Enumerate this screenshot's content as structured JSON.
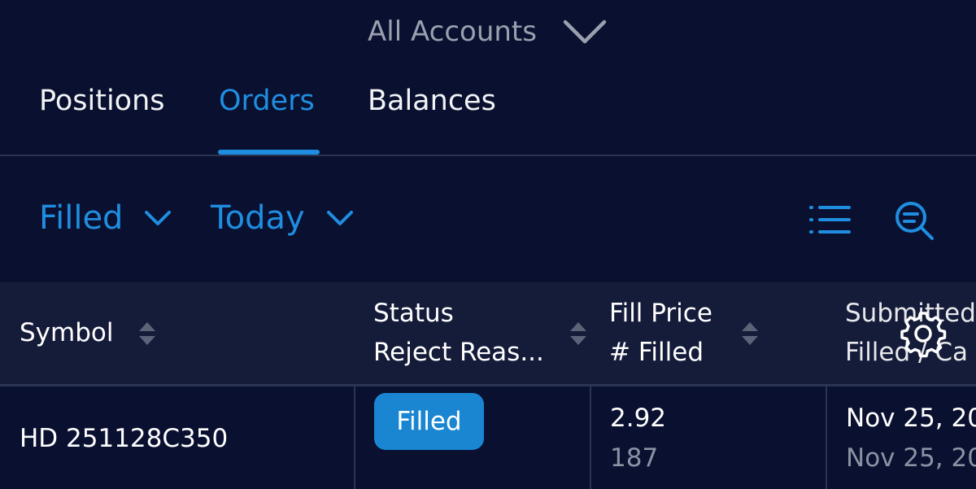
{
  "account_selector": {
    "label": "All Accounts",
    "icon": "chevron-down-icon"
  },
  "tabs": [
    {
      "label": "Positions",
      "active": false
    },
    {
      "label": "Orders",
      "active": true
    },
    {
      "label": "Balances",
      "active": false
    }
  ],
  "filters": {
    "status": {
      "label": "Filled",
      "icon": "chevron-down-icon"
    },
    "period": {
      "label": "Today",
      "icon": "chevron-down-icon"
    },
    "actions": [
      {
        "icon": "list-icon"
      },
      {
        "icon": "search-icon"
      }
    ]
  },
  "table": {
    "headers": [
      {
        "line1": "Symbol",
        "line2": ""
      },
      {
        "line1": "Status",
        "line2": "Reject Reas..."
      },
      {
        "line1": "Fill Price",
        "line2": "# Filled"
      },
      {
        "line1": "Submitted",
        "line2": "Filled / Ca"
      }
    ],
    "settings_icon": "gear-icon",
    "rows": [
      {
        "symbol": "HD 251128C350",
        "status": "Filled",
        "fill_price": "2.92",
        "filled_count": "187",
        "submitted": "Nov 25, 20",
        "filled_date": "Nov 25, 20"
      }
    ]
  },
  "colors": {
    "background": "#0a1030",
    "header_background": "#151c3a",
    "accent": "#1f8ee0",
    "badge": "#1a86d2",
    "muted": "#8b92a3"
  }
}
